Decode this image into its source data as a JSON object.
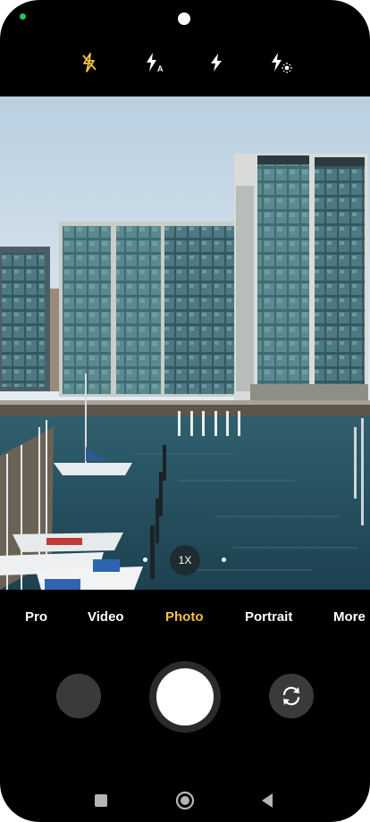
{
  "status": {
    "privacy_indicator": "green"
  },
  "flash_modes": [
    "flash-off",
    "flash-auto",
    "flash-on",
    "flash-torch"
  ],
  "zoom": {
    "label": "1X"
  },
  "modes": [
    "Pro",
    "Video",
    "Photo",
    "Portrait",
    "More"
  ],
  "active_mode": "Photo",
  "colors": {
    "accent": "#f5c242",
    "background": "#000000"
  },
  "nav": [
    "recents-square-icon",
    "home-circle-icon",
    "back-triangle-icon"
  ]
}
